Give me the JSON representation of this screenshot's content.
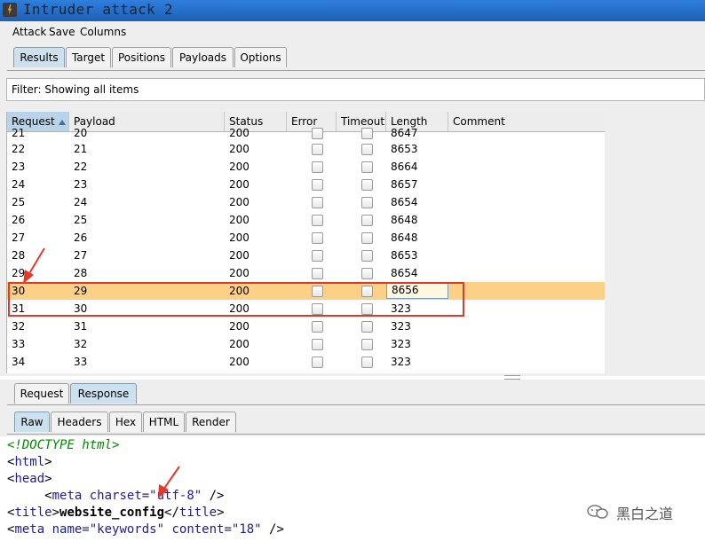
{
  "window": {
    "title": "Intruder attack 2"
  },
  "menu": [
    "Attack",
    "Save",
    "Columns"
  ],
  "tabs": [
    "Results",
    "Target",
    "Positions",
    "Payloads",
    "Options"
  ],
  "filter": {
    "text": "Filter: Showing all items"
  },
  "table": {
    "columns": [
      "Request",
      "Payload",
      "Status",
      "Error",
      "Timeout",
      "Length",
      "Comment"
    ],
    "sorted_column": "Request",
    "partial_row": {
      "request": "21",
      "payload": "20",
      "status": "200",
      "length": "8647"
    },
    "rows": [
      {
        "request": "22",
        "payload": "21",
        "status": "200",
        "length": "8653"
      },
      {
        "request": "23",
        "payload": "22",
        "status": "200",
        "length": "8664"
      },
      {
        "request": "24",
        "payload": "23",
        "status": "200",
        "length": "8657"
      },
      {
        "request": "25",
        "payload": "24",
        "status": "200",
        "length": "8654"
      },
      {
        "request": "26",
        "payload": "25",
        "status": "200",
        "length": "8648"
      },
      {
        "request": "27",
        "payload": "26",
        "status": "200",
        "length": "8648"
      },
      {
        "request": "28",
        "payload": "27",
        "status": "200",
        "length": "8653"
      },
      {
        "request": "29",
        "payload": "28",
        "status": "200",
        "length": "8654"
      },
      {
        "request": "30",
        "payload": "29",
        "status": "200",
        "length": "8656",
        "selected": true
      },
      {
        "request": "31",
        "payload": "30",
        "status": "200",
        "length": "323"
      },
      {
        "request": "32",
        "payload": "31",
        "status": "200",
        "length": "323"
      },
      {
        "request": "33",
        "payload": "32",
        "status": "200",
        "length": "323"
      },
      {
        "request": "34",
        "payload": "33",
        "status": "200",
        "length": "323"
      }
    ]
  },
  "message_tabs": [
    "Request",
    "Response"
  ],
  "view_tabs": [
    "Raw",
    "Headers",
    "Hex",
    "HTML",
    "Render"
  ],
  "code": {
    "l1": "<!DOCTYPE html>",
    "l2_open": "<",
    "l2_tag": "html",
    "l2_close": ">",
    "l3_open": "<",
    "l3_tag": "head",
    "l3_close": ">",
    "l4_indent": "     ",
    "l4_open": "<",
    "l4_tag": "meta",
    "l4_attr": " charset=",
    "l4_val": "\"utf-8\"",
    "l4_end": " />",
    "l5_open": "<",
    "l5_tag": "title",
    "l5_gt": ">",
    "l5_text": "website_config",
    "l5_close_open": "</",
    "l5_close_tag": "title",
    "l5_close_gt": ">",
    "l6_open": "<",
    "l6_tag": "meta",
    "l6_attr1": " name=",
    "l6_val1": "\"keywords\"",
    "l6_attr2": " content=",
    "l6_val2": "\"18\"",
    "l6_end": " />"
  },
  "watermark": {
    "text": "黑白之道"
  },
  "colors": {
    "selected_row": "#fdd088",
    "annotation": "#e23a2a",
    "active_tab": "#cde0ee"
  }
}
